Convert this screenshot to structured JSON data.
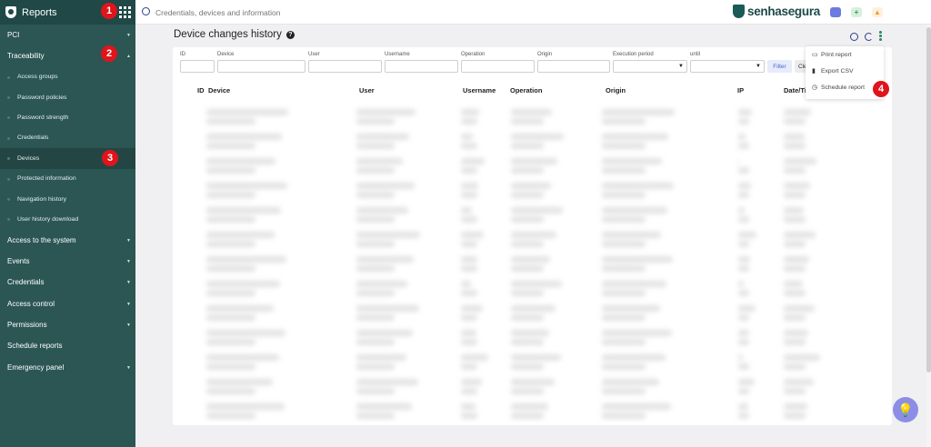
{
  "sidebar": {
    "title": "Reports",
    "items": [
      {
        "label": "PCI",
        "expandable": true
      },
      {
        "label": "Traceability",
        "expandable": true,
        "expanded": true
      },
      {
        "label": "Access to the system",
        "expandable": true
      },
      {
        "label": "Events",
        "expandable": true
      },
      {
        "label": "Credentials",
        "expandable": true
      },
      {
        "label": "Access control",
        "expandable": true
      },
      {
        "label": "Permissions",
        "expandable": true
      },
      {
        "label": "Schedule reports",
        "expandable": false
      },
      {
        "label": "Emergency panel",
        "expandable": true
      }
    ],
    "traceability_subitems": [
      {
        "label": "Access groups"
      },
      {
        "label": "Password policies"
      },
      {
        "label": "Password strength"
      },
      {
        "label": "Credentials"
      },
      {
        "label": "Devices",
        "active": true
      },
      {
        "label": "Protected information"
      },
      {
        "label": "Navigation history"
      },
      {
        "label": "User history download"
      }
    ]
  },
  "topbar": {
    "search_placeholder": "Credentials, devices and information",
    "brand": "senhasegura"
  },
  "page": {
    "title": "Device changes history",
    "help_icon": "?"
  },
  "filters": {
    "id_label": "ID",
    "device_label": "Device",
    "user_label": "User",
    "username_label": "Username",
    "operation_label": "Operation",
    "origin_label": "Origin",
    "execution_period_label": "Execution period",
    "until_label": "until",
    "filter_button": "Filter",
    "clear_button": "Cle"
  },
  "table": {
    "columns": [
      "ID",
      "Device",
      "User",
      "Username",
      "Operation",
      "Origin",
      "IP",
      "Date/Ti"
    ]
  },
  "menu": {
    "items": [
      "Print report",
      "Export CSV",
      "Schedule report"
    ]
  },
  "badges": [
    "1",
    "2",
    "3",
    "4"
  ],
  "colors": {
    "sidebar_bg": "#2b5654",
    "badge_red": "#e0141b",
    "accent_blue": "#2b3f8c",
    "fab_purple": "#8c8ee6"
  }
}
